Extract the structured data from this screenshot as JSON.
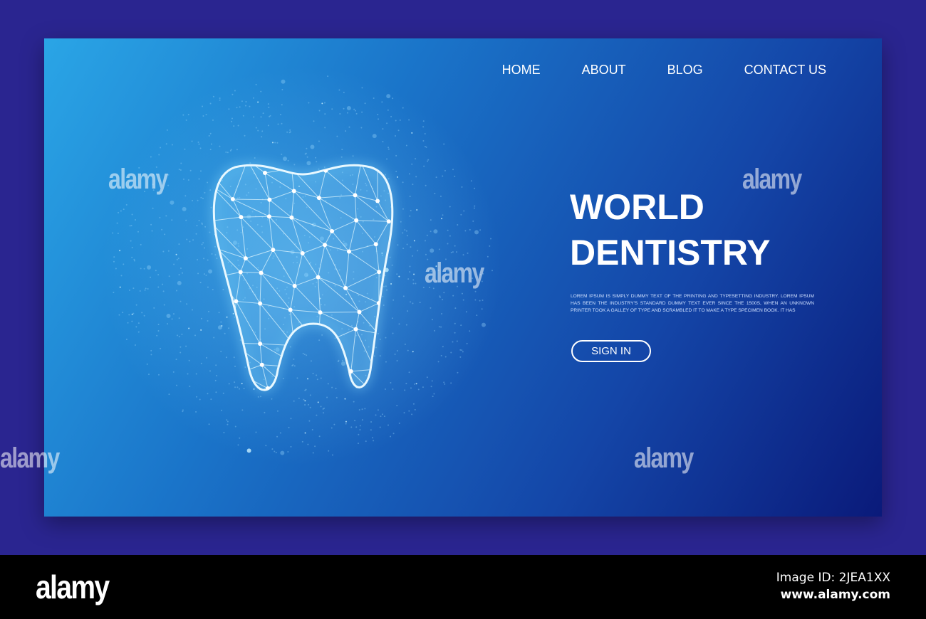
{
  "nav": {
    "items": [
      "HOME",
      "ABOUT",
      "BLOG",
      "CONTACT US"
    ]
  },
  "hero": {
    "title_line1": "WORLD",
    "title_line2": "DENTISTRY",
    "body": "Lorem Ipsum is simply dummy text of the printing and typesetting industry. Lorem Ipsum has been the industry's standard dummy text ever since the 1500s, when an unknown printer took a galley of type and scrambled it to make a type specimen book. It has",
    "signin_label": "SIGN IN"
  },
  "illustration": {
    "icon": "tooth-polygon-mesh-icon",
    "background": "dotted-globe"
  },
  "colors": {
    "page_bg": "#2a2590",
    "card_start": "#2aa5e6",
    "card_end": "#0a1a7a"
  },
  "watermark": {
    "text": "alamy"
  },
  "footer": {
    "logo": "alamy",
    "image_id": "Image ID: 2JEA1XX",
    "site": "www.alamy.com"
  }
}
